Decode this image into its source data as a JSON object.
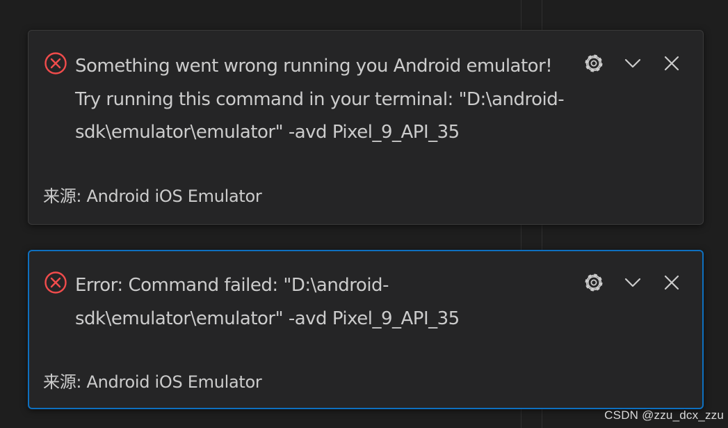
{
  "notifications": [
    {
      "message_lines": [
        "Something went wrong running you Android emulator!",
        "Try running this command in your terminal: \"D:\\android-",
        "sdk\\emulator\\emulator\" -avd Pixel_9_API_35"
      ],
      "source": "来源: Android iOS Emulator",
      "severity": "error",
      "focused": false
    },
    {
      "message_lines": [
        "Error: Command failed: \"D:\\android-",
        "sdk\\emulator\\emulator\" -avd Pixel_9_API_35"
      ],
      "source": "来源: Android iOS Emulator",
      "severity": "error",
      "focused": true
    }
  ],
  "toolbar_icons": [
    "gear-icon",
    "chevron-down-icon",
    "close-icon"
  ],
  "colors": {
    "background": "#1e1e1e",
    "toast_background": "#252526",
    "text": "#cccccc",
    "error": "#f14c4c",
    "focus_border": "#0e70c0"
  },
  "watermark": "CSDN @zzu_dcx_zzu"
}
